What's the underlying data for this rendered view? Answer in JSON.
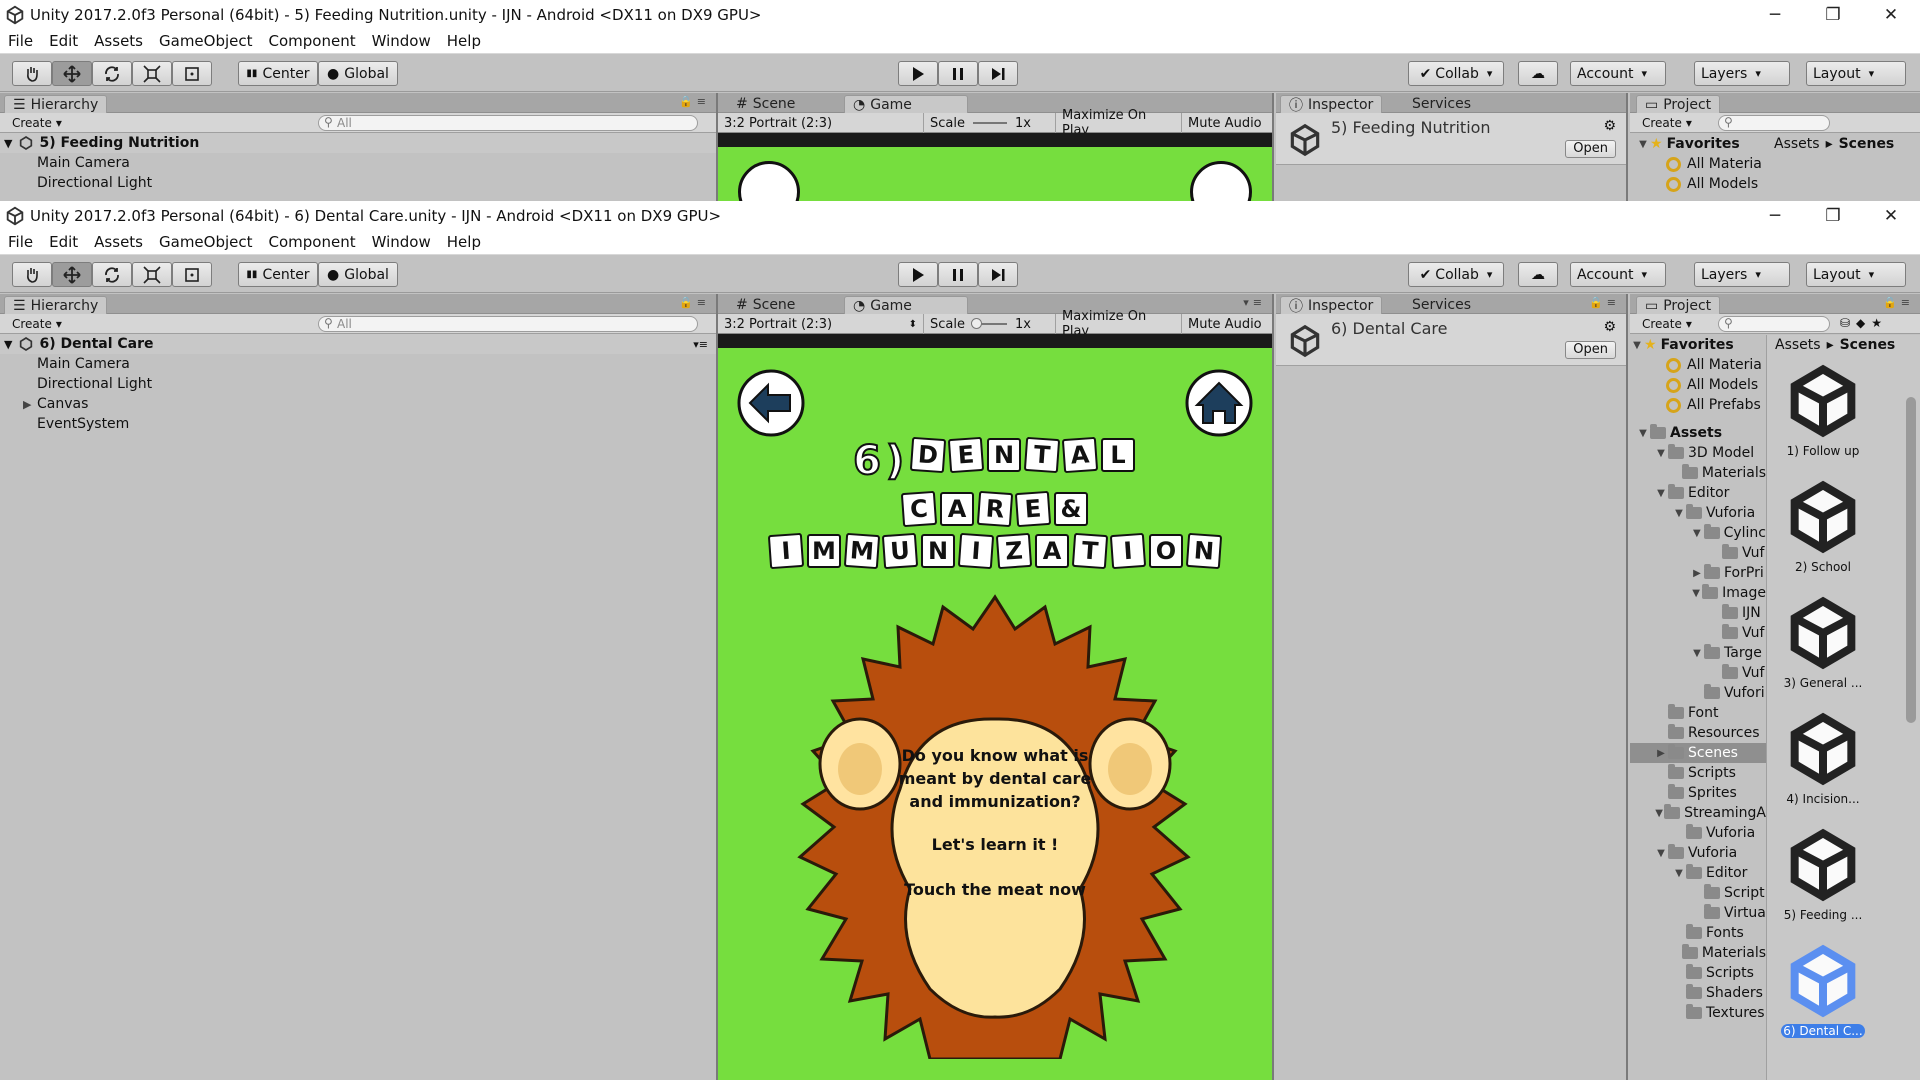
{
  "window_back": {
    "title": "Unity 2017.2.0f3 Personal (64bit) - 5) Feeding Nutrition.unity - IJN - Android <DX11 on DX9 GPU>",
    "scene_name": "5) Feeding Nutrition",
    "hierarchy_items": [
      "Main Camera",
      "Directional Light"
    ],
    "inspector_name": "5) Feeding Nutrition",
    "favorites": [
      "All Materia",
      "All Models"
    ]
  },
  "window_front": {
    "title": "Unity 2017.2.0f3 Personal (64bit) - 6) Dental Care.unity - IJN - Android <DX11 on DX9 GPU>",
    "scene_name": "6) Dental Care",
    "hierarchy_items": [
      {
        "label": "Main Camera",
        "expandable": false
      },
      {
        "label": "Directional Light",
        "expandable": false
      },
      {
        "label": "Canvas",
        "expandable": true
      },
      {
        "label": "EventSystem",
        "expandable": false
      }
    ],
    "inspector_name": "6) Dental Care"
  },
  "menu": [
    "File",
    "Edit",
    "Assets",
    "GameObject",
    "Component",
    "Window",
    "Help"
  ],
  "toolbar": {
    "pivot": "Center",
    "space": "Global",
    "collab": "Collab",
    "account": "Account",
    "layers": "Layers",
    "layout": "Layout"
  },
  "panels": {
    "hierarchy": "Hierarchy",
    "scene": "Scene",
    "game": "Game",
    "inspector": "Inspector",
    "services": "Services",
    "project": "Project",
    "create": "Create",
    "search_placeholder": "All",
    "open": "Open"
  },
  "gamebar": {
    "aspect": "3:2 Portrait (2:3)",
    "scale_label": "Scale",
    "scale_value": "1x",
    "maximize": "Maximize On Play",
    "mute": "Mute Audio"
  },
  "game": {
    "title_line1": "6)DENTAL",
    "title_line2": "CARE&",
    "title_line3": "IMMUNIZATION",
    "question": "Do you know what is meant by dental care and immunization?",
    "learn": "Let's learn it !",
    "touch": "Touch the meat now",
    "bg_color": "#76de3e"
  },
  "project": {
    "favorites_label": "Favorites",
    "favorites": [
      "All Materia",
      "All Models",
      "All Prefabs"
    ],
    "breadcrumb": [
      "Assets",
      "Scenes"
    ],
    "tree": [
      {
        "label": "Assets",
        "depth": 0,
        "arrow": "down",
        "bold": true
      },
      {
        "label": "3D Model",
        "depth": 1,
        "arrow": "down"
      },
      {
        "label": "Materials",
        "depth": 2,
        "arrow": ""
      },
      {
        "label": "Editor",
        "depth": 1,
        "arrow": "down"
      },
      {
        "label": "Vuforia",
        "depth": 2,
        "arrow": "down"
      },
      {
        "label": "Cylinc",
        "depth": 3,
        "arrow": "down"
      },
      {
        "label": "Vuf",
        "depth": 4,
        "arrow": ""
      },
      {
        "label": "ForPri",
        "depth": 3,
        "arrow": "right"
      },
      {
        "label": "Image",
        "depth": 3,
        "arrow": "down"
      },
      {
        "label": "IJN",
        "depth": 4,
        "arrow": ""
      },
      {
        "label": "Vuf",
        "depth": 4,
        "arrow": ""
      },
      {
        "label": "Targe",
        "depth": 3,
        "arrow": "down"
      },
      {
        "label": "Vuf",
        "depth": 4,
        "arrow": ""
      },
      {
        "label": "Vufori",
        "depth": 3,
        "arrow": ""
      },
      {
        "label": "Font",
        "depth": 1,
        "arrow": ""
      },
      {
        "label": "Resources",
        "depth": 1,
        "arrow": ""
      },
      {
        "label": "Scenes",
        "depth": 1,
        "arrow": "right",
        "selected": true
      },
      {
        "label": "Scripts",
        "depth": 1,
        "arrow": ""
      },
      {
        "label": "Sprites",
        "depth": 1,
        "arrow": ""
      },
      {
        "label": "StreamingA",
        "depth": 1,
        "arrow": "down"
      },
      {
        "label": "Vuforia",
        "depth": 2,
        "arrow": ""
      },
      {
        "label": "Vuforia",
        "depth": 1,
        "arrow": "down"
      },
      {
        "label": "Editor",
        "depth": 2,
        "arrow": "down"
      },
      {
        "label": "Script",
        "depth": 3,
        "arrow": ""
      },
      {
        "label": "Virtua",
        "depth": 3,
        "arrow": ""
      },
      {
        "label": "Fonts",
        "depth": 2,
        "arrow": ""
      },
      {
        "label": "Materials",
        "depth": 2,
        "arrow": ""
      },
      {
        "label": "Scripts",
        "depth": 2,
        "arrow": ""
      },
      {
        "label": "Shaders",
        "depth": 2,
        "arrow": ""
      },
      {
        "label": "Textures",
        "depth": 2,
        "arrow": ""
      }
    ],
    "scenes": [
      "1) Follow up",
      "2) School",
      "3) General ...",
      "4) Incision...",
      "5) Feeding ...",
      "6) Dental C..."
    ],
    "selected_scene": "6) Dental C..."
  }
}
